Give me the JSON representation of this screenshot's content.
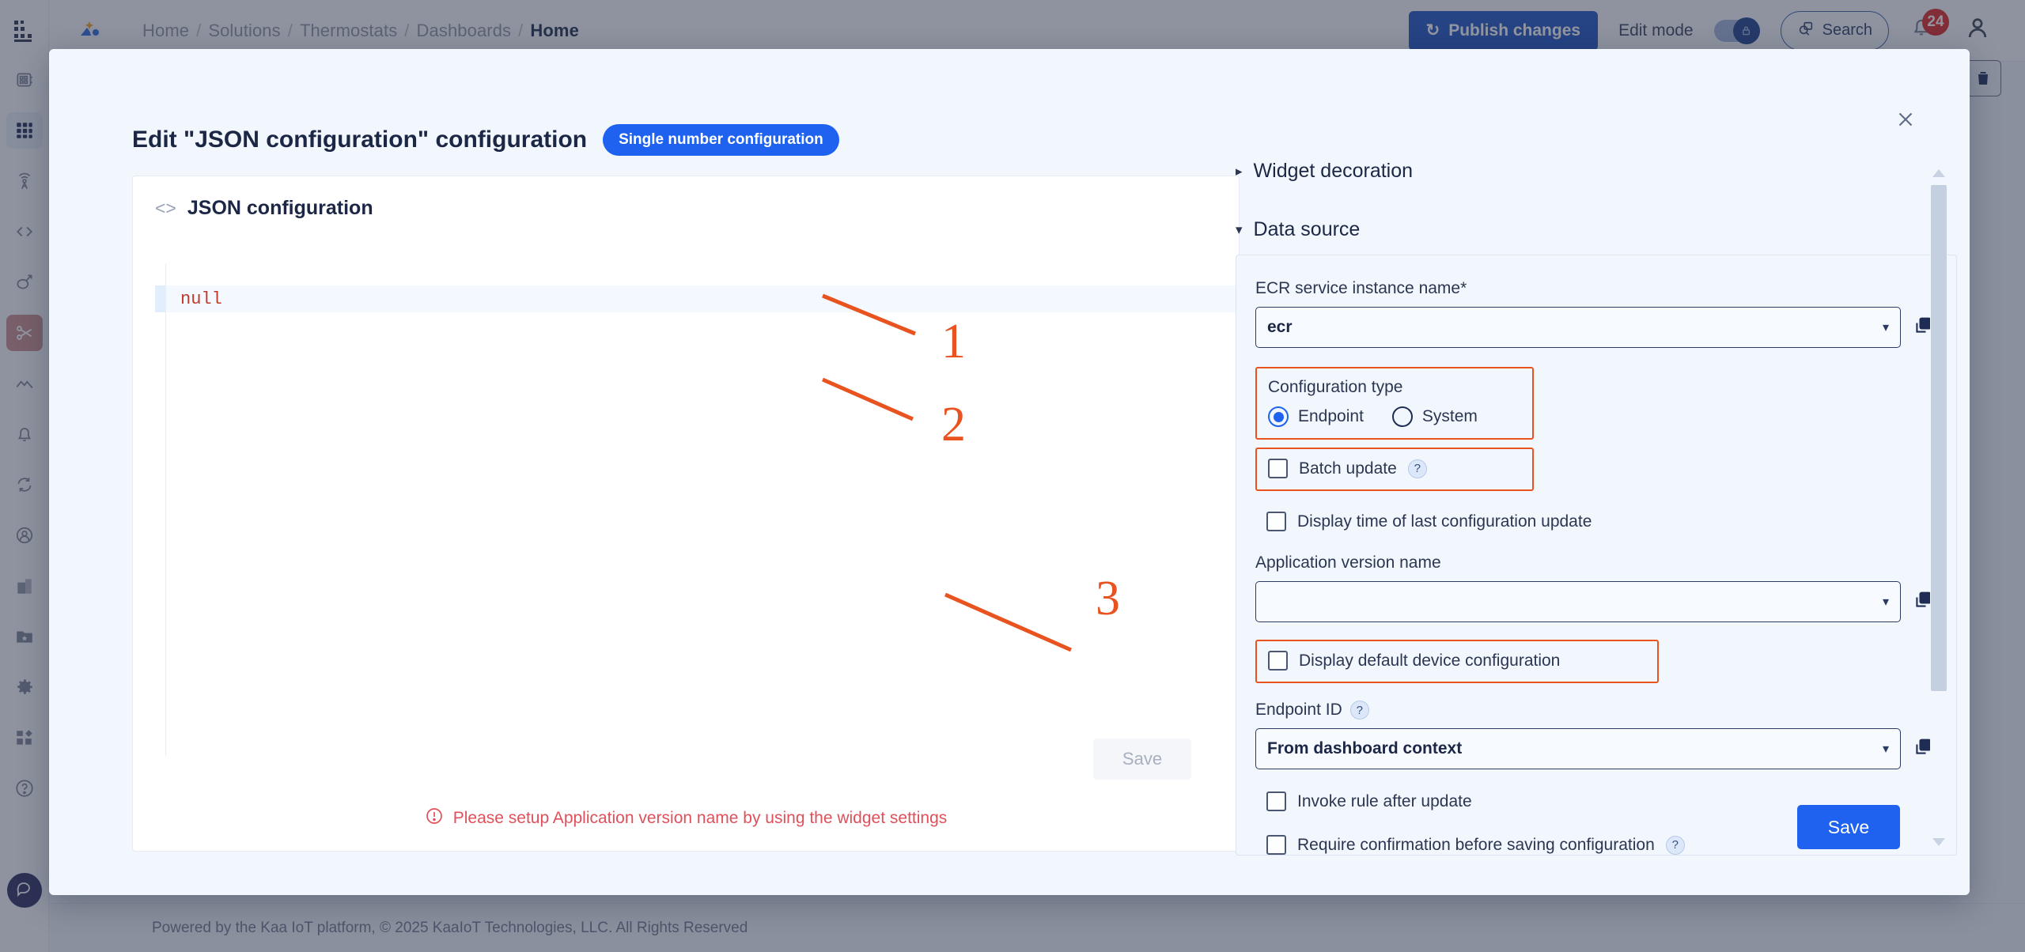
{
  "app": {
    "breadcrumb": [
      "Home",
      "Solutions",
      "Thermostats",
      "Dashboards",
      "Home"
    ],
    "publish_label": "Publish changes",
    "edit_mode_label": "Edit mode",
    "search_label": "Search",
    "notification_count": "24",
    "footer": "Powered by the Kaa IoT platform, © 2025 KaaIoT Technologies, LLC. All Rights Reserved"
  },
  "sidebar": {
    "items": [
      {
        "name": "devices-icon"
      },
      {
        "name": "dashboards-icon"
      },
      {
        "name": "antenna-icon"
      },
      {
        "name": "code-icon"
      },
      {
        "name": "link-icon"
      },
      {
        "name": "scissors-icon"
      },
      {
        "name": "analytics-icon"
      },
      {
        "name": "bell-icon"
      },
      {
        "name": "sync-icon"
      },
      {
        "name": "user-icon"
      },
      {
        "name": "building-icon"
      },
      {
        "name": "folder-star-icon"
      },
      {
        "name": "gear-icon"
      },
      {
        "name": "apps-icon"
      },
      {
        "name": "help-icon"
      }
    ]
  },
  "modal": {
    "title": "Edit \"JSON configuration\" configuration",
    "pill": "Single number configuration",
    "save_label": "Save",
    "close_label": "×"
  },
  "json_panel": {
    "heading": "JSON configuration",
    "code_value": "null",
    "save_label": "Save",
    "error": "Please setup Application version name by using the widget settings"
  },
  "settings": {
    "widget_decoration": "Widget decoration",
    "data_source": "Data source",
    "ecr_label": "ECR service instance name",
    "ecr_required_mark": "*",
    "ecr_value": "ecr",
    "config_type_label": "Configuration type",
    "radio_endpoint": "Endpoint",
    "radio_system": "System",
    "batch_update": "Batch update",
    "display_time_last_update": "Display time of last configuration update",
    "app_version_label": "Application version name",
    "app_version_value": "",
    "display_default_device_config": "Display default device configuration",
    "endpoint_id_label": "Endpoint ID",
    "endpoint_id_value": "From dashboard context",
    "invoke_rule": "Invoke rule after update",
    "require_confirmation": "Require confirmation before saving configuration",
    "help_glyph": "?"
  },
  "annotations": {
    "one": "1",
    "two": "2",
    "three": "3",
    "color": "#e8531f"
  }
}
